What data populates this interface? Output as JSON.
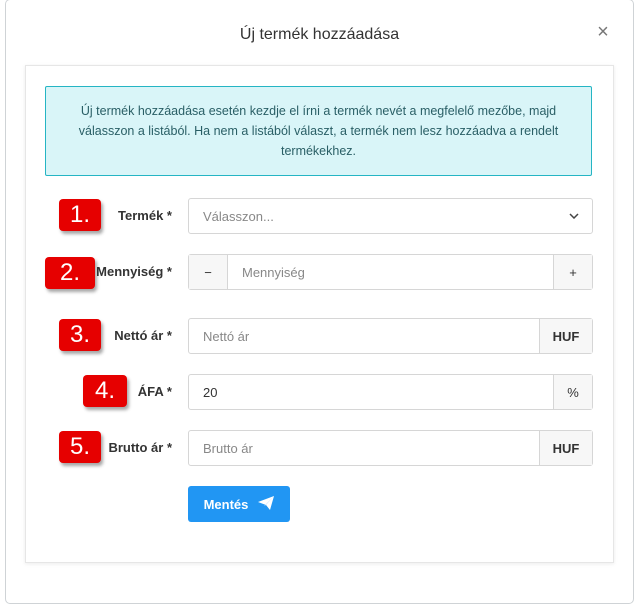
{
  "modal": {
    "title": "Új termék hozzáadása",
    "close_label": "×"
  },
  "info": {
    "text": "Új termék hozzáadása esetén kezdje el írni a termék nevét a megfelelő mezőbe, majd válasszon a listából. Ha nem a listából választ, a termék nem lesz hozzáadva a rendelt termékekhez."
  },
  "badges": [
    "1.",
    "2.",
    "3.",
    "4.",
    "5."
  ],
  "fields": {
    "product": {
      "label": "Termék *",
      "placeholder": "Válasszon..."
    },
    "quantity": {
      "label": "Mennyiség *",
      "placeholder": "Mennyiség",
      "minus": "−",
      "plus": "+"
    },
    "net_price": {
      "label": "Nettó ár *",
      "placeholder": "Nettó ár",
      "unit": "HUF"
    },
    "vat": {
      "label": "ÁFA *",
      "value": "20",
      "unit": "%"
    },
    "gross_price": {
      "label": "Brutto ár *",
      "placeholder": "Brutto ár",
      "unit": "HUF"
    }
  },
  "save_button": {
    "label": "Mentés",
    "icon": "paper-plane-icon"
  },
  "colors": {
    "accent": "#2196f3",
    "badge": "#e60000",
    "info_bg": "#d9f5f8",
    "info_border": "#25b5c4"
  }
}
